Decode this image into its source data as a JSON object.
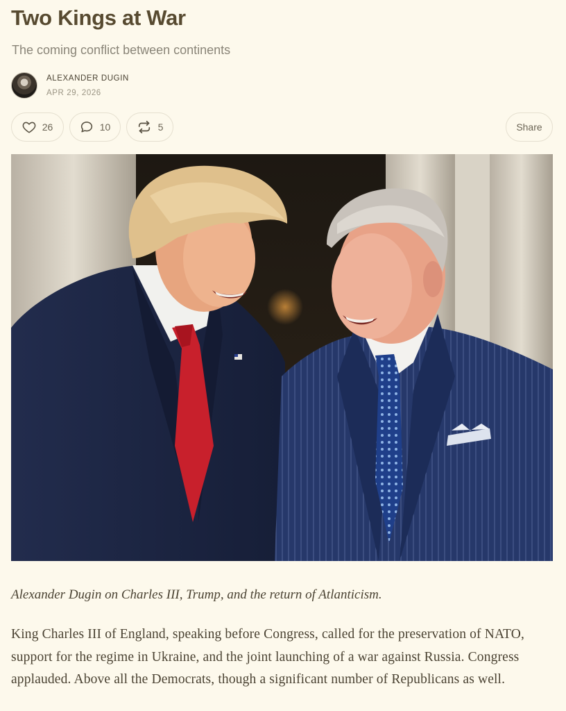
{
  "article": {
    "title": "Two Kings at War",
    "subtitle": "The coming conflict between continents",
    "author": "ALEXANDER DUGIN",
    "date": "APR 29, 2026"
  },
  "actions": {
    "likes": "26",
    "comments": "10",
    "restacks": "5",
    "share_label": "Share",
    "icons": [
      "heart-icon",
      "comment-icon",
      "restack-icon"
    ]
  },
  "hero": {
    "description": "photo-two-men-laughing"
  },
  "caption": "Alexander Dugin on Charles III, Trump, and the return of Atlanticism.",
  "body": [
    "King Charles III of England, speaking before Congress, called for the preservation of NATO, support for the regime in Ukraine, and the joint launching of a war against Russia. Congress applauded. Above all the Democrats, though a significant number of Republicans as well."
  ],
  "colors": {
    "background": "#fdf9ec",
    "title": "#574a30",
    "tie_red": "#c8202c",
    "suit_navy": "#1d2748"
  }
}
